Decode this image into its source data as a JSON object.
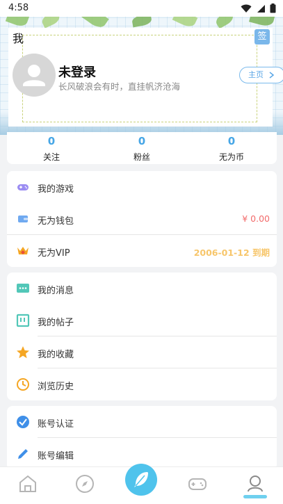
{
  "status_bar": {
    "time": "4:58"
  },
  "profile": {
    "title": "我",
    "sign_label": "签",
    "username": "未登录",
    "slogan": "长风破浪会有时，直挂帆济沧海",
    "home_label": "主页"
  },
  "stats": [
    {
      "value": "0",
      "label": "关注"
    },
    {
      "value": "0",
      "label": "粉丝"
    },
    {
      "value": "0",
      "label": "无为币"
    }
  ],
  "group1": [
    {
      "label": "我的游戏",
      "icon": "gamepad-icon"
    },
    {
      "label": "无为钱包",
      "icon": "wallet-icon",
      "value": "¥ 0.00",
      "value_color": "#f26b6b"
    },
    {
      "label": "无为VIP",
      "icon": "vip-crown-icon",
      "value": "2006-01-12 到期",
      "value_color": "#f7c66b"
    }
  ],
  "group2": [
    {
      "label": "我的消息",
      "icon": "message-icon"
    },
    {
      "label": "我的帖子",
      "icon": "post-icon"
    },
    {
      "label": "我的收藏",
      "icon": "star-icon"
    },
    {
      "label": "浏览历史",
      "icon": "history-clock-icon"
    }
  ],
  "group3": [
    {
      "label": "账号认证",
      "icon": "verify-check-icon"
    },
    {
      "label": "账号编辑",
      "icon": "pencil-icon"
    }
  ],
  "colors": {
    "accent": "#4fc3ec",
    "link": "#46a6e6",
    "money": "#f26b6b",
    "vip": "#f7c66b"
  },
  "tabs": [
    "home-tab",
    "discover-tab",
    "post-tab",
    "game-tab",
    "profile-tab"
  ]
}
